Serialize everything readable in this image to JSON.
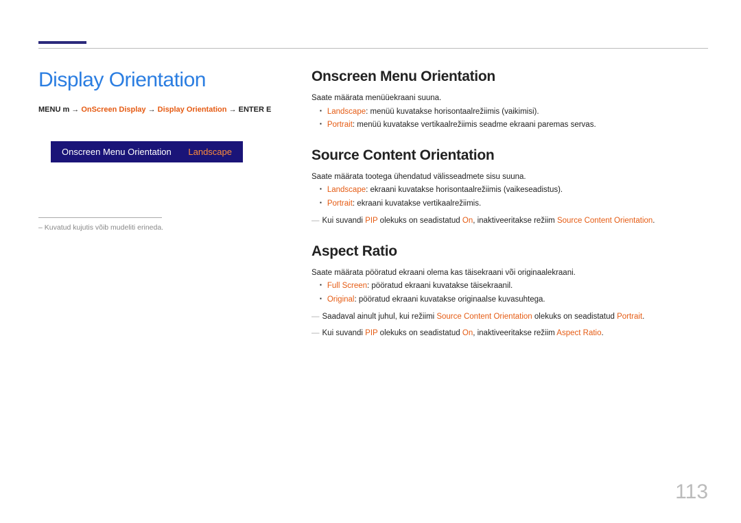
{
  "page_title": "Display Orientation",
  "breadcrumb": {
    "menu": "MENU m",
    "arrow": "→",
    "p1": "OnScreen Display",
    "p2": "Display Orientation",
    "enter": "ENTER E"
  },
  "menu_box": {
    "label": "Onscreen Menu Orientation",
    "value": "Landscape"
  },
  "footnote": "– Kuvatud kujutis võib mudeliti erineda.",
  "s1": {
    "title": "Onscreen Menu Orientation",
    "desc": "Saate määrata menüüekraani suuna.",
    "b1_key": "Landscape",
    "b1_txt": ": menüü kuvatakse horisontaalrežiimis (vaikimisi).",
    "b2_key": "Portrait",
    "b2_txt": ": menüü kuvatakse vertikaalrežiimis seadme ekraani paremas servas."
  },
  "s2": {
    "title": "Source Content Orientation",
    "desc": "Saate määrata tootega ühendatud välisseadmete sisu suuna.",
    "b1_key": "Landscape",
    "b1_txt": ": ekraani kuvatakse horisontaalrežiimis (vaikeseadistus).",
    "b2_key": "Portrait",
    "b2_txt": ": ekraani kuvatakse vertikaalrežiimis.",
    "n1_a": "Kui suvandi ",
    "n1_b": "PIP",
    "n1_c": " olekuks on seadistatud ",
    "n1_d": "On",
    "n1_e": ", inaktiveeritakse režiim ",
    "n1_f": "Source Content Orientation",
    "n1_g": "."
  },
  "s3": {
    "title": "Aspect Ratio",
    "desc": "Saate määrata pööratud ekraani olema kas täisekraani või originaalekraani.",
    "b1_key": "Full Screen",
    "b1_txt": ": pööratud ekraani kuvatakse täisekraanil.",
    "b2_key": "Original",
    "b2_txt": ": pööratud ekraani kuvatakse originaalse kuvasuhtega.",
    "n1_a": "Saadaval ainult juhul, kui režiimi ",
    "n1_b": "Source Content Orientation",
    "n1_c": " olekuks on seadistatud ",
    "n1_d": "Portrait",
    "n1_e": ".",
    "n2_a": "Kui suvandi ",
    "n2_b": "PIP",
    "n2_c": " olekuks on seadistatud ",
    "n2_d": "On",
    "n2_e": ", inaktiveeritakse režiim ",
    "n2_f": "Aspect Ratio",
    "n2_g": "."
  },
  "page_number": "113"
}
